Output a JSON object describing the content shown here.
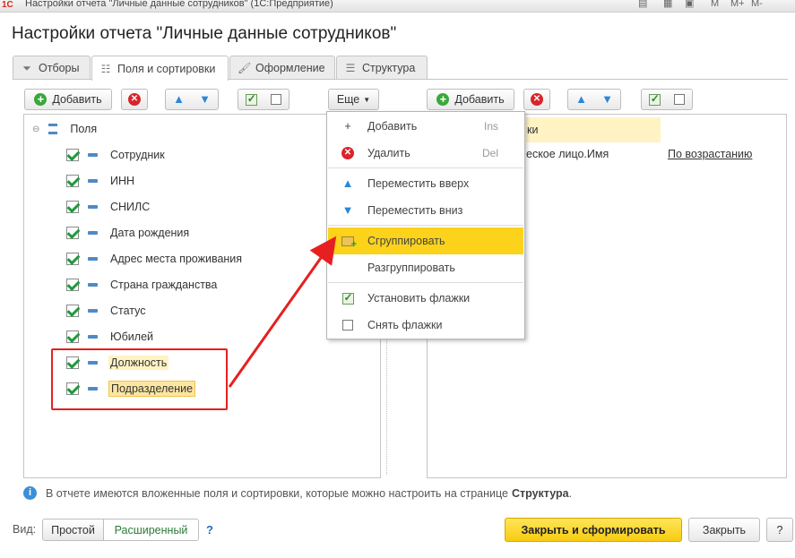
{
  "window": {
    "app_logo": "1С",
    "title": "Настройки отчета \"Личные данные сотрудников\" (1С:Предприятие)",
    "toolbar_buttons": [
      "M",
      "M+",
      "M-"
    ]
  },
  "page_title": "Настройки отчета \"Личные данные сотрудников\"",
  "tabs": [
    {
      "label": "Отборы",
      "icon": "filter-icon"
    },
    {
      "label": "Поля и сортировки",
      "icon": "fields-icon"
    },
    {
      "label": "Оформление",
      "icon": "brush-icon"
    },
    {
      "label": "Структура",
      "icon": "structure-icon"
    }
  ],
  "left_toolbar": {
    "add_label": "Добавить",
    "more_label": "Еще"
  },
  "right_toolbar": {
    "add_label": "Добавить"
  },
  "tree": {
    "root_label": "Поля",
    "items": [
      {
        "label": "Сотрудник",
        "checked": true
      },
      {
        "label": "ИНН",
        "checked": true
      },
      {
        "label": "СНИЛС",
        "checked": true
      },
      {
        "label": "Дата рождения",
        "checked": true
      },
      {
        "label": "Адрес места проживания",
        "checked": true
      },
      {
        "label": "Страна гражданства",
        "checked": true
      },
      {
        "label": "Статус",
        "checked": true
      },
      {
        "label": "Юбилей",
        "checked": true
      },
      {
        "label": "Должность",
        "checked": true
      },
      {
        "label": "Подразделение",
        "checked": true
      }
    ]
  },
  "sort_panel": {
    "header_fragment": "ки",
    "row_field": "еское лицо.Имя",
    "row_order": "По возрастанию"
  },
  "context_menu": {
    "items": [
      {
        "label": "Добавить",
        "shortcut": "Ins",
        "icon": "plus-icon"
      },
      {
        "label": "Удалить",
        "shortcut": "Del",
        "icon": "delete-icon"
      },
      {
        "label": "Переместить вверх",
        "shortcut": "",
        "icon": "arrow-up-icon"
      },
      {
        "label": "Переместить вниз",
        "shortcut": "",
        "icon": "arrow-down-icon"
      },
      {
        "label": "Сгруппировать",
        "shortcut": "",
        "icon": "group-icon"
      },
      {
        "label": "Разгруппировать",
        "shortcut": "",
        "icon": ""
      },
      {
        "label": "Установить флажки",
        "shortcut": "",
        "icon": "check-all-icon"
      },
      {
        "label": "Снять флажки",
        "shortcut": "",
        "icon": "uncheck-all-icon"
      }
    ],
    "highlighted": "Сгруппировать"
  },
  "info": {
    "text": "В отчете имеются вложенные поля и сортировки, которые можно настроить на странице",
    "link": "Структура",
    "suffix": "."
  },
  "footer": {
    "view_label": "Вид:",
    "simple_label": "Простой",
    "extended_label": "Расширенный",
    "help_label": "?",
    "close_generate_label": "Закрыть и сформировать",
    "close_label": "Закрыть",
    "extra_label": "?"
  },
  "colors": {
    "accent_yellow": "#fcd21b",
    "annotation_red": "#e62020",
    "check_green": "#1f9a3e"
  }
}
